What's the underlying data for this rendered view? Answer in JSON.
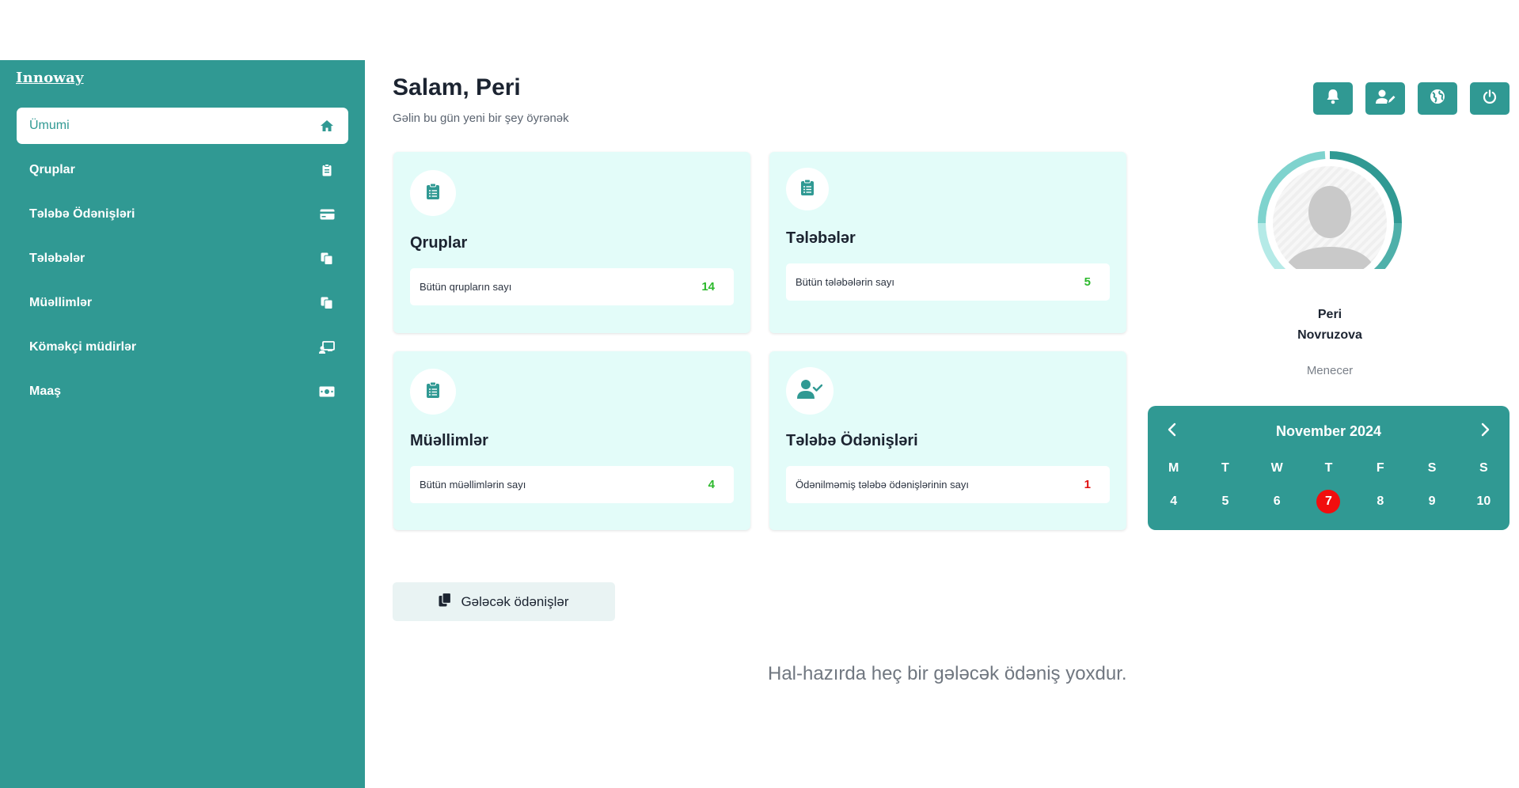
{
  "app": {
    "brand": "Innoway"
  },
  "sidebar": {
    "items": [
      {
        "label": "Ümumi",
        "icon": "home-icon",
        "active": true
      },
      {
        "label": "Qruplar",
        "icon": "clipboard-icon",
        "active": false
      },
      {
        "label": "Tələbə Ödənişləri",
        "icon": "credit-card-icon",
        "active": false
      },
      {
        "label": "Tələbələr",
        "icon": "copy-icon",
        "active": false
      },
      {
        "label": "Müəllimlər",
        "icon": "copy-icon",
        "active": false
      },
      {
        "label": "Köməkçi müdirlər",
        "icon": "chalkboard-user-icon",
        "active": false
      },
      {
        "label": "Maaş",
        "icon": "money-bill-icon",
        "active": false
      }
    ]
  },
  "header": {
    "greeting": "Salam, Peri",
    "subtitle": "Gəlin bu gün yeni bir şey öyrənək",
    "actions": [
      "bell-icon",
      "user-edit-icon",
      "globe-icon",
      "power-icon"
    ]
  },
  "cards": [
    {
      "title": "Qruplar",
      "label": "Bütün qrupların sayı",
      "value": "14",
      "icon": "clipboard-list-icon"
    },
    {
      "title": "Tələbələr",
      "label": "Bütün tələbələrin sayı",
      "value": "5",
      "icon": "clipboard-list-icon"
    },
    {
      "title": "Müəllimlər",
      "label": "Bütün müəllimlərin sayı",
      "value": "4",
      "icon": "clipboard-list-icon"
    },
    {
      "title": "Tələbə Ödənişləri",
      "label": "Ödənilməmiş tələbə ödənişlərinin sayı",
      "value": "1",
      "icon": "user-check-icon"
    }
  ],
  "upcoming": {
    "button_label": "Gələcək ödənişlər",
    "empty_message": "Hal-hazırda heç bir gələcək ödəniş yoxdur."
  },
  "profile": {
    "first_name": "Peri",
    "last_name": "Novruzova",
    "role": "Menecer"
  },
  "calendar": {
    "month": "November 2024",
    "weekdays": [
      "M",
      "T",
      "W",
      "T",
      "F",
      "S",
      "S"
    ],
    "days": [
      "4",
      "5",
      "6",
      "7",
      "8",
      "9",
      "10"
    ],
    "today": "7"
  },
  "colors": {
    "primary": "#309993",
    "card_bg": "#e3fcf9",
    "value_green": "#2cb92c",
    "value_red": "#e01010",
    "today_red": "#f10e0e"
  }
}
